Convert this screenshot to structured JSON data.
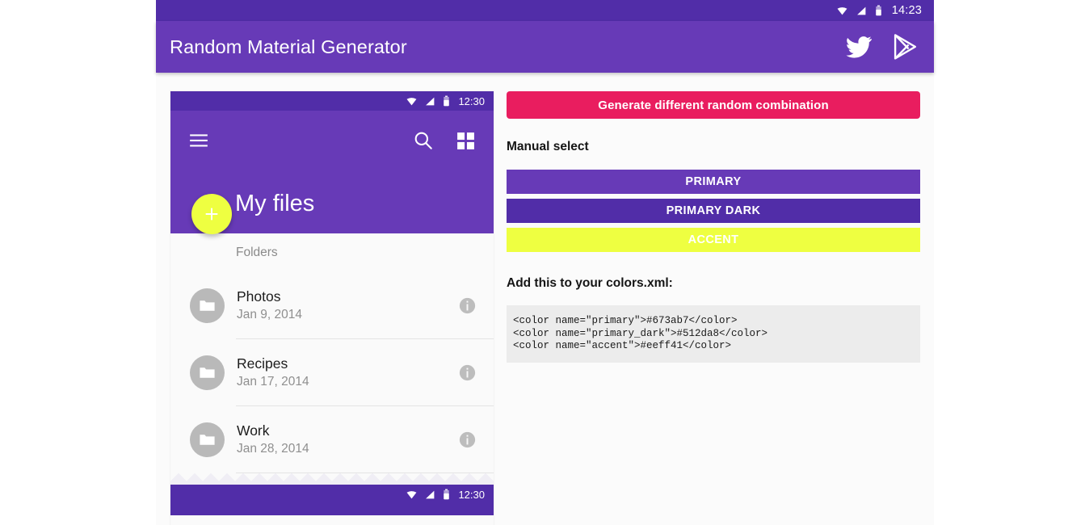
{
  "status_bar": {
    "time": "14:23",
    "icons": [
      "wifi-icon",
      "signal-icon",
      "battery-icon"
    ]
  },
  "header": {
    "title": "Random Material Generator",
    "actions": [
      {
        "name": "twitter-icon",
        "label": "Twitter"
      },
      {
        "name": "google-play-icon",
        "label": "Google Play"
      }
    ],
    "background": "#673ab7",
    "status_background": "#512da8"
  },
  "preview": {
    "status_bar": {
      "time": "12:30"
    },
    "toolbar": {
      "menu_icon": "hamburger-menu-icon",
      "search_icon": "search-icon",
      "grid_icon": "grid-view-icon"
    },
    "title": "My files",
    "fab": {
      "icon": "plus-icon",
      "color": "#eeff41"
    },
    "subheader": "Folders",
    "rows": [
      {
        "title": "Photos",
        "subtitle": "Jan 9, 2014"
      },
      {
        "title": "Recipes",
        "subtitle": "Jan 17, 2014"
      },
      {
        "title": "Work",
        "subtitle": "Jan 28, 2014"
      }
    ],
    "bottom_status_bar": {
      "time": "12:30"
    }
  },
  "panel": {
    "generate_button": "Generate different random combination",
    "generate_button_color": "#e91d5f",
    "manual_select_label": "Manual select",
    "swatches": [
      {
        "label": "PRIMARY",
        "color": "#673ab7"
      },
      {
        "label": "PRIMARY DARK",
        "color": "#512da8"
      },
      {
        "label": "ACCENT",
        "color": "#eeff41"
      }
    ],
    "xml_label": "Add this to your colors.xml:",
    "xml_code": "<color name=\"primary\">#673ab7</color>\n<color name=\"primary_dark\">#512da8</color>\n<color name=\"accent\">#eeff41</color>"
  }
}
